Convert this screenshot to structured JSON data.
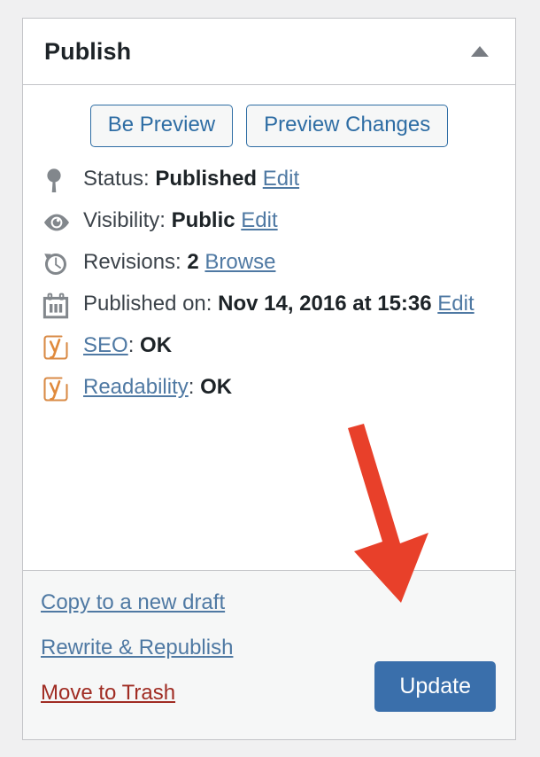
{
  "panel": {
    "title": "Publish",
    "toggle_icon": "triangle-up-icon"
  },
  "minor_actions": {
    "preview_button_label": "Be Preview",
    "preview_changes_button_label": "Preview Changes"
  },
  "misc_actions": [
    {
      "icon": "pin-icon",
      "label": "Status:",
      "value": "Published",
      "link": "Edit"
    },
    {
      "icon": "eye-icon",
      "label": "Visibility:",
      "value": "Public",
      "link": "Edit"
    },
    {
      "icon": "revisions-clock-icon",
      "label": "Revisions:",
      "value": "2",
      "link": "Browse"
    },
    {
      "icon": "calendar-icon",
      "label": "Published on:",
      "value": "Nov 14, 2016 at 15:36",
      "link": "Edit"
    },
    {
      "icon": "yoast-icon",
      "link": "SEO",
      "label": ":",
      "value": "OK"
    },
    {
      "icon": "yoast-icon",
      "link": "Readability",
      "label": ":",
      "value": "OK"
    }
  ],
  "footer": {
    "links": [
      {
        "label": "Copy to a new draft",
        "style": "blue"
      },
      {
        "label": "Rewrite & Republish",
        "style": "blue"
      },
      {
        "label": "Move to Trash",
        "style": "red"
      }
    ],
    "update_button_label": "Update"
  },
  "annotation": {
    "arrow_color": "#E8402A",
    "arrow_name": "red-arrow-pointing-to-update-button"
  },
  "colors": {
    "page_background": "#f0f0f1",
    "card_background": "#ffffff",
    "card_border": "#c3c4c7",
    "footer_background": "#f6f7f7",
    "link_blue": "#4f79a3",
    "button_border_blue": "#2e6da4",
    "primary_button_blue": "#3a6fab",
    "trash_red": "#a02c23",
    "icon_gray": "#82878c",
    "yoast_orange": "#d98b47",
    "text_dark": "#1d2327"
  }
}
